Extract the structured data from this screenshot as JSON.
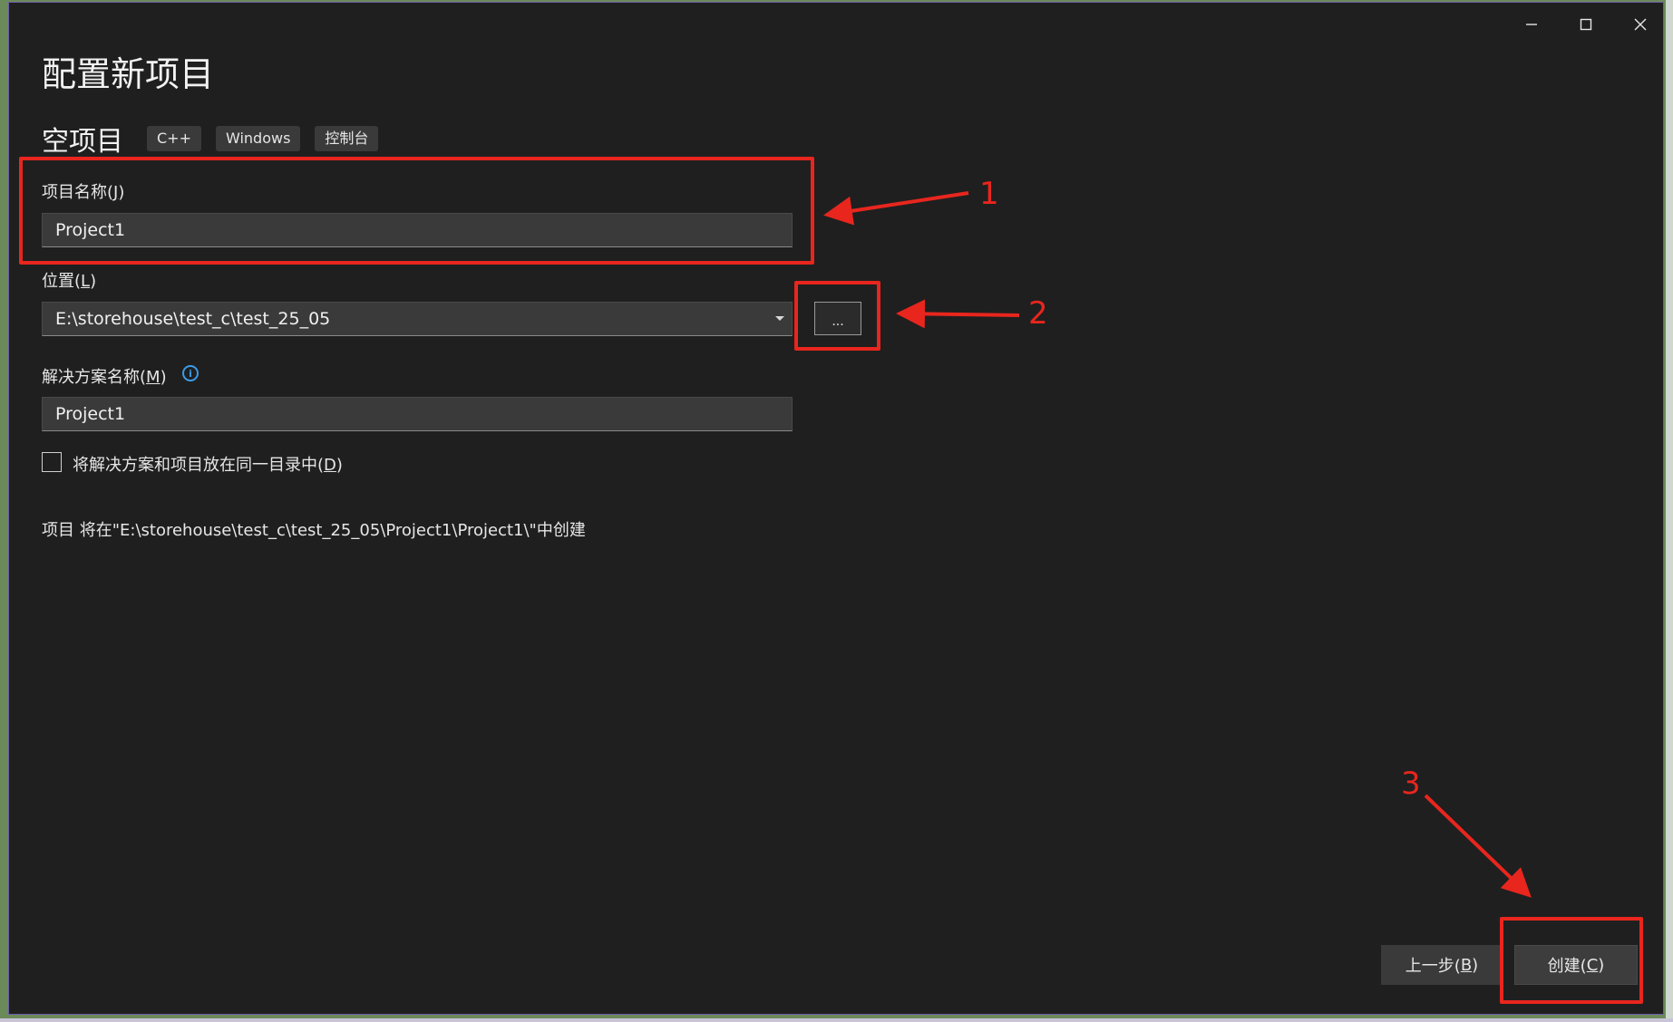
{
  "window": {
    "title": "配置新项目",
    "template_name": "空项目",
    "tags": [
      "C++",
      "Windows",
      "控制台"
    ]
  },
  "caption_buttons": {
    "minimize_icon": "minimize-icon",
    "maximize_icon": "maximize-icon",
    "close_icon": "close-icon"
  },
  "form": {
    "project_name": {
      "label": "项目名称(",
      "accel": "J",
      "label_end": ")",
      "value": "Project1"
    },
    "location": {
      "label": "位置(",
      "accel": "L",
      "label_end": ")",
      "value": "E:\\storehouse\\test_c\\test_25_05",
      "browse_label": "..."
    },
    "solution_name": {
      "label": "解决方案名称(",
      "accel": "M",
      "label_end": ")",
      "value": "Project1",
      "info_icon": "info-icon"
    },
    "same_dir": {
      "label": "将解决方案和项目放在同一目录中(",
      "accel": "D",
      "label_end": ")",
      "checked": false
    },
    "path_note": "项目 将在\"E:\\storehouse\\test_c\\test_25_05\\Project1\\Project1\\\"中创建"
  },
  "buttons": {
    "back": {
      "label": "上一步(",
      "accel": "B",
      "label_end": ")"
    },
    "create": {
      "label": "创建(",
      "accel": "C",
      "label_end": ")"
    }
  },
  "annotations": {
    "color": "#e8261e",
    "numbers": [
      "1",
      "2",
      "3"
    ]
  }
}
